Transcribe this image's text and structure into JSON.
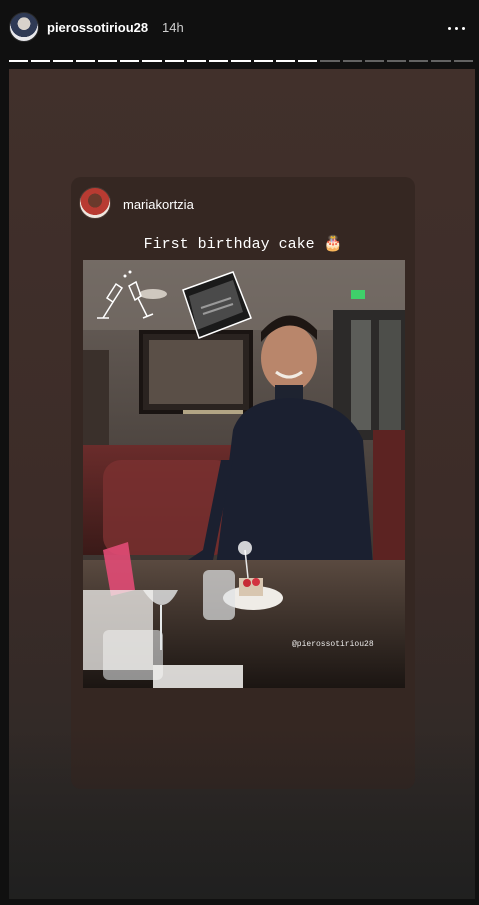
{
  "header": {
    "username": "pierossotiriou28",
    "timestamp": "14h",
    "more_icon": "more-horizontal-icon"
  },
  "progress": {
    "segments_total": 21,
    "segments_viewed": 14
  },
  "card": {
    "username": "mariakortzia",
    "caption": "First birthday cake 🎂",
    "watermark": "@pierossotiriou28",
    "stickers": [
      "champagne-glasses-icon",
      "money-briefcase-icon"
    ]
  },
  "colors": {
    "background": "#101010",
    "story_bg": "#41302b",
    "text": "#ffffff"
  }
}
